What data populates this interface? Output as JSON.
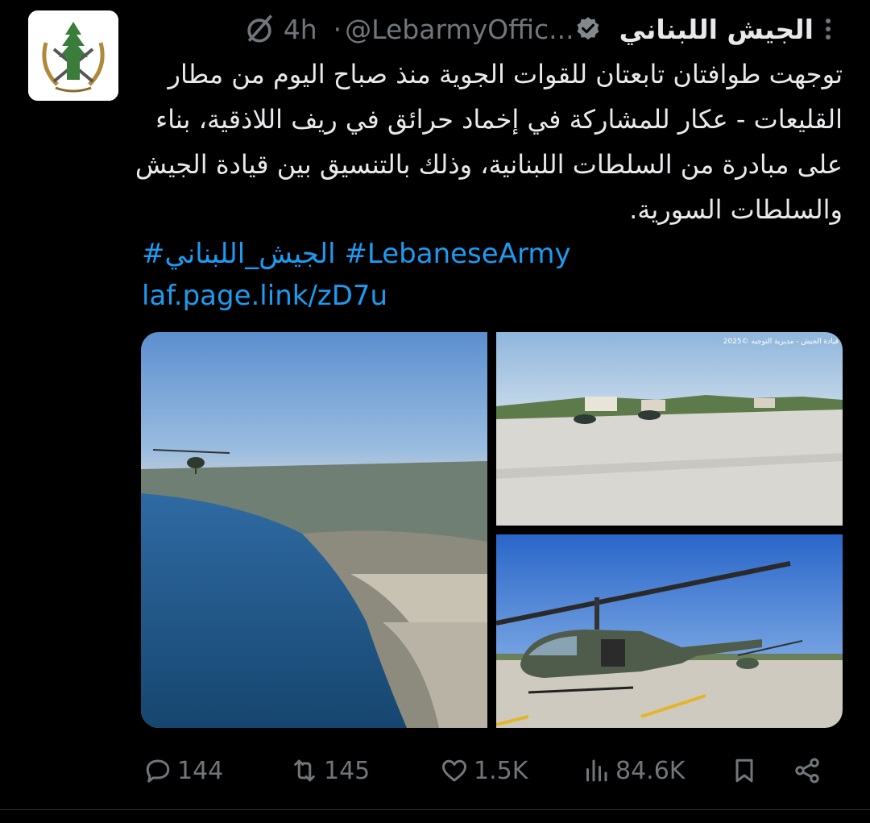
{
  "tweet": {
    "author_name": "الجيش اللبناني",
    "handle": "@LebarmyOffic...",
    "separator": "·",
    "time": "4h",
    "text": "توجهت طوافتان تابعتان للقوات الجوية منذ صباح اليوم من مطار القليعات - عكار للمشاركة في إخماد حرائق في ريف اللاذقية، بناء على مبادرة من السلطات اللبنانية، وذلك بالتنسيق بين قيادة الجيش والسلطات السورية.",
    "hashtag_1": "#الجيش_اللبناني",
    "hashtag_2": "#LebaneseArmy",
    "link": "laf.page.link/zD7u",
    "photo_caption": "قيادة الجيش - مديرية التوجيه ©2025"
  },
  "icons": {
    "avatar": "lebanese-army-emblem",
    "verified": "verified-badge-icon",
    "mute": "mute-icon",
    "more": "more-vertical-icon"
  },
  "actions": {
    "replies": "144",
    "retweets": "145",
    "likes": "1.5K",
    "views": "84.6K"
  },
  "colors": {
    "background": "#000000",
    "text": "#e7e9ea",
    "secondary": "#71767b",
    "accent": "#1d9bf0"
  }
}
